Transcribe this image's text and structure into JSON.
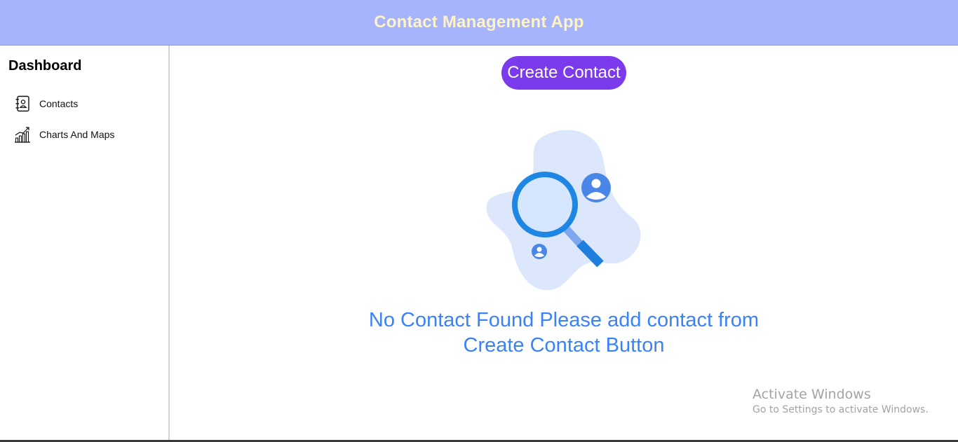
{
  "header": {
    "title": "Contact Management App",
    "bg_color": "#a5b4fc",
    "title_color": "#fef3c7"
  },
  "sidebar": {
    "title": "Dashboard",
    "items": [
      {
        "label": "Contacts",
        "icon": "contacts-book-icon"
      },
      {
        "label": "Charts And Maps",
        "icon": "bar-chart-trend-icon"
      }
    ]
  },
  "main": {
    "create_button_label": "Create Contact",
    "create_button_color": "#7c3aed",
    "empty_illustration_icon": "search-contact-illustration-icon",
    "empty_message_line1": "No Contact Found Please add contact from",
    "empty_message_line2": "Create Contact Button",
    "message_color": "#3b82f6"
  },
  "watermark": {
    "title": "Activate Windows",
    "subtitle": "Go to Settings to activate Windows."
  }
}
